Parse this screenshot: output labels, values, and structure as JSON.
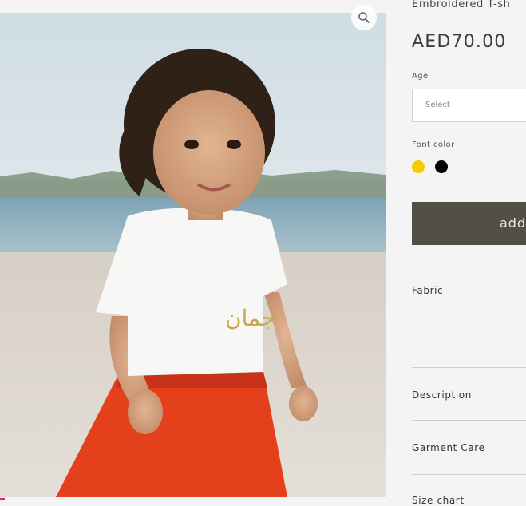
{
  "product": {
    "title": "Embroidered T-sh",
    "price": "AED70.00",
    "image_alt": "Girl in white embroidered t-shirt with Arabic name and red tulle skirt on beach",
    "embroidery_text": "جمان"
  },
  "options": {
    "age_label": "Age",
    "age_placeholder": "Select",
    "font_color_label": "Font color",
    "font_colors": [
      "#f3cd00",
      "#000000"
    ]
  },
  "actions": {
    "add_label": "add"
  },
  "accordion": [
    {
      "label": "Fabric"
    },
    {
      "label": "Description"
    },
    {
      "label": "Garment Care"
    },
    {
      "label": "Size chart"
    }
  ],
  "colors": {
    "add_button_bg": "#524f46",
    "page_bg": "#f4f4f4"
  },
  "icons": {
    "zoom": "search-icon"
  }
}
